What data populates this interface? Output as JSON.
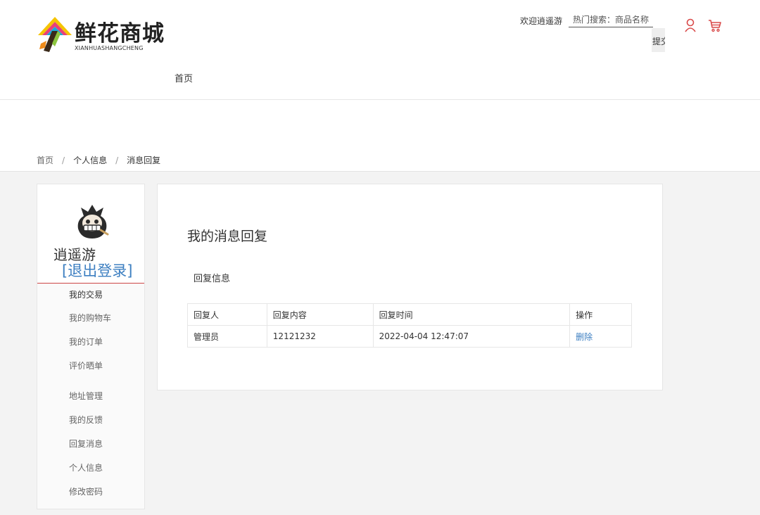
{
  "header": {
    "logo_title": "鲜花商城",
    "logo_subtitle": "XIANHUASHANGCHENG",
    "welcome": "欢迎逍遥游",
    "search_placeholder": "热门搜索：商品名称",
    "search_button": "提交",
    "nav_home": "首页"
  },
  "breadcrumb": [
    "首页",
    "个人信息",
    "消息回复"
  ],
  "breadcrumb_separator": "/",
  "sidebar": {
    "username": "逍遥游",
    "logout": "[退出登录]",
    "items": [
      "我的交易",
      "我的购物车",
      "我的订单",
      "评价晒单",
      "地址管理",
      "我的反馈",
      "回复消息",
      "个人信息",
      "修改密码"
    ]
  },
  "main": {
    "title": "我的消息回复",
    "section_label": "回复信息",
    "table": {
      "headers": [
        "回复人",
        "回复内容",
        "回复时间",
        "操作"
      ],
      "rows": [
        {
          "replier": "管理员",
          "content": "12121232",
          "time": "2022-04-04 12:47:07",
          "action": "删除"
        }
      ]
    }
  },
  "colors": {
    "accent_link": "#3d7fc1",
    "divider_red": "#cc4444",
    "page_gray": "#f3f3f3"
  },
  "icons": [
    "logo-mark-icon",
    "user-icon",
    "cart-icon",
    "avatar-icon"
  ]
}
